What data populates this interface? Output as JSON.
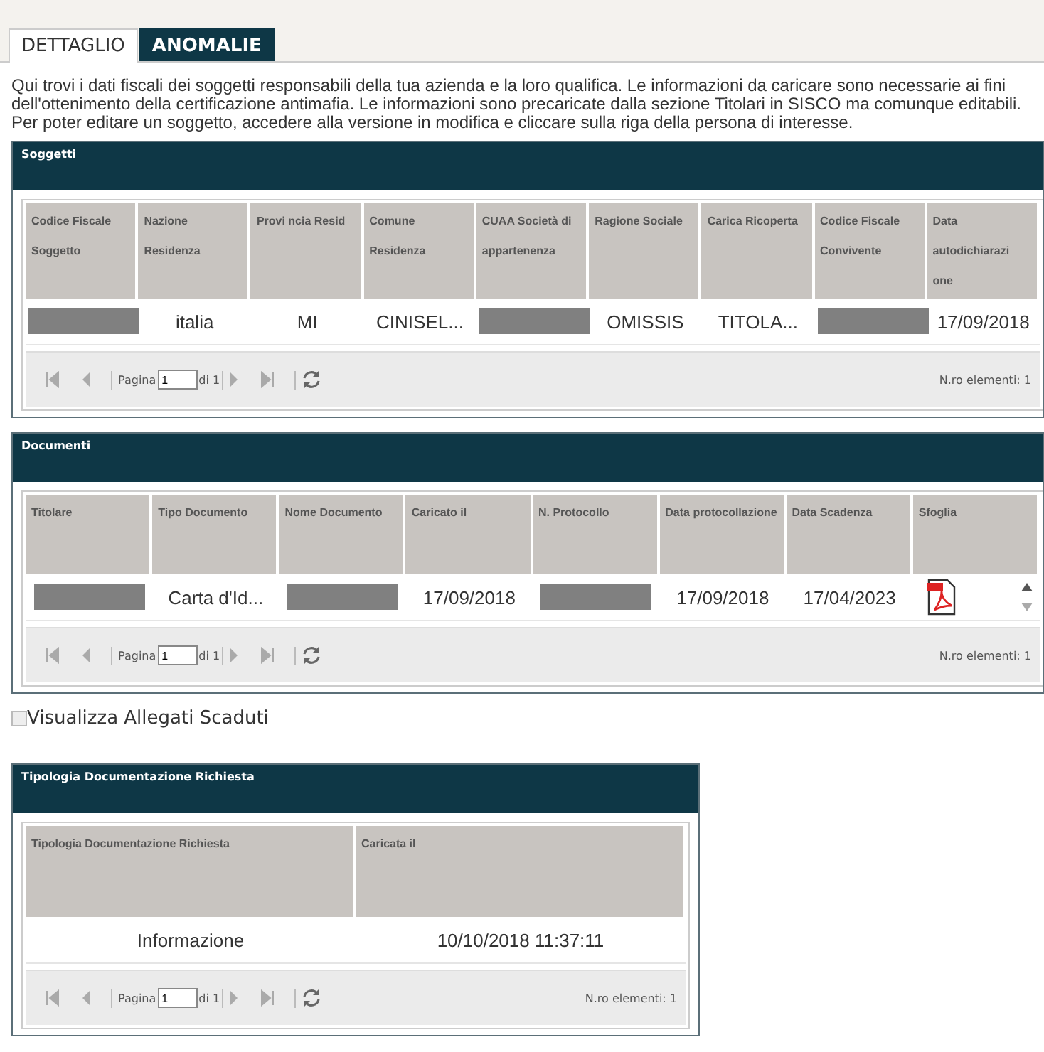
{
  "tabs": [
    {
      "label": "DETTAGLIO",
      "selected": false
    },
    {
      "label": "ANOMALIE",
      "selected": true
    }
  ],
  "intro": "Qui trovi i dati fiscali dei soggetti responsabili della tua azienda e la loro qualifica. Le informazioni da caricare sono necessarie ai fini dell'ottenimento della certificazione antimafia. Le informazioni sono precaricate dalla sezione Titolari in SISCO ma comunque editabili. Per poter editare un soggetto, accedere alla versione in modifica e cliccare sulla riga della persona di interesse.",
  "sections": [
    {
      "kind": "grid",
      "title": "Soggetti",
      "columns": [
        "Codice Fiscale Soggetto",
        "Nazione Residenza",
        "Provi ncia Resid",
        "Comune Residenza",
        "CUAA Società di appartenenza",
        "Ragione Sociale",
        "Carica Ricoperta",
        "Codice Fiscale Convivente",
        "Data autodichiarazi one"
      ],
      "rows": [
        [
          {
            "kind": "redacted"
          },
          {
            "kind": "text",
            "text": "italia"
          },
          {
            "kind": "text",
            "text": "MI"
          },
          {
            "kind": "text",
            "text": "CINISEL..."
          },
          {
            "kind": "redacted"
          },
          {
            "kind": "text",
            "text": "OMISSIS"
          },
          {
            "kind": "text",
            "text": "TITOLA..."
          },
          {
            "kind": "redacted"
          },
          {
            "kind": "text",
            "text": "17/09/2018"
          }
        ]
      ],
      "pager": {
        "page_label": "Pagina",
        "page": "1",
        "page_total": "di 1",
        "count": "N.ro elementi: 1"
      }
    },
    {
      "kind": "grid",
      "title": "Documenti",
      "columns": [
        "Titolare",
        "Tipo Documento",
        "Nome Documento",
        "Caricato il",
        "N. Protocollo",
        "Data protocollazione",
        "Data Scadenza",
        "Sfoglia"
      ],
      "rows": [
        [
          {
            "kind": "redacted"
          },
          {
            "kind": "text",
            "text": "Carta d'Id..."
          },
          {
            "kind": "redacted"
          },
          {
            "kind": "text",
            "text": "17/09/2018"
          },
          {
            "kind": "redacted"
          },
          {
            "kind": "text",
            "text": "17/09/2018"
          },
          {
            "kind": "text",
            "text": "17/04/2023"
          },
          {
            "kind": "pdf"
          }
        ]
      ],
      "pager": {
        "page_label": "Pagina",
        "page": "1",
        "page_total": "di 1",
        "count": "N.ro elementi: 1"
      }
    },
    {
      "kind": "checkbox",
      "label": "Visualizza Allegati Scaduti",
      "checked": false
    },
    {
      "kind": "grid",
      "title": "Tipologia Documentazione Richiesta",
      "columns": [
        "Tipologia Documentazione Richiesta",
        "Caricata il"
      ],
      "rows": [
        [
          {
            "kind": "text",
            "text": "Informazione"
          },
          {
            "kind": "text",
            "text": "10/10/2018 11:37:11"
          }
        ]
      ],
      "pager": {
        "page_label": "Pagina",
        "page": "1",
        "page_total": "di 1",
        "count": "N.ro elementi: 1"
      }
    }
  ]
}
